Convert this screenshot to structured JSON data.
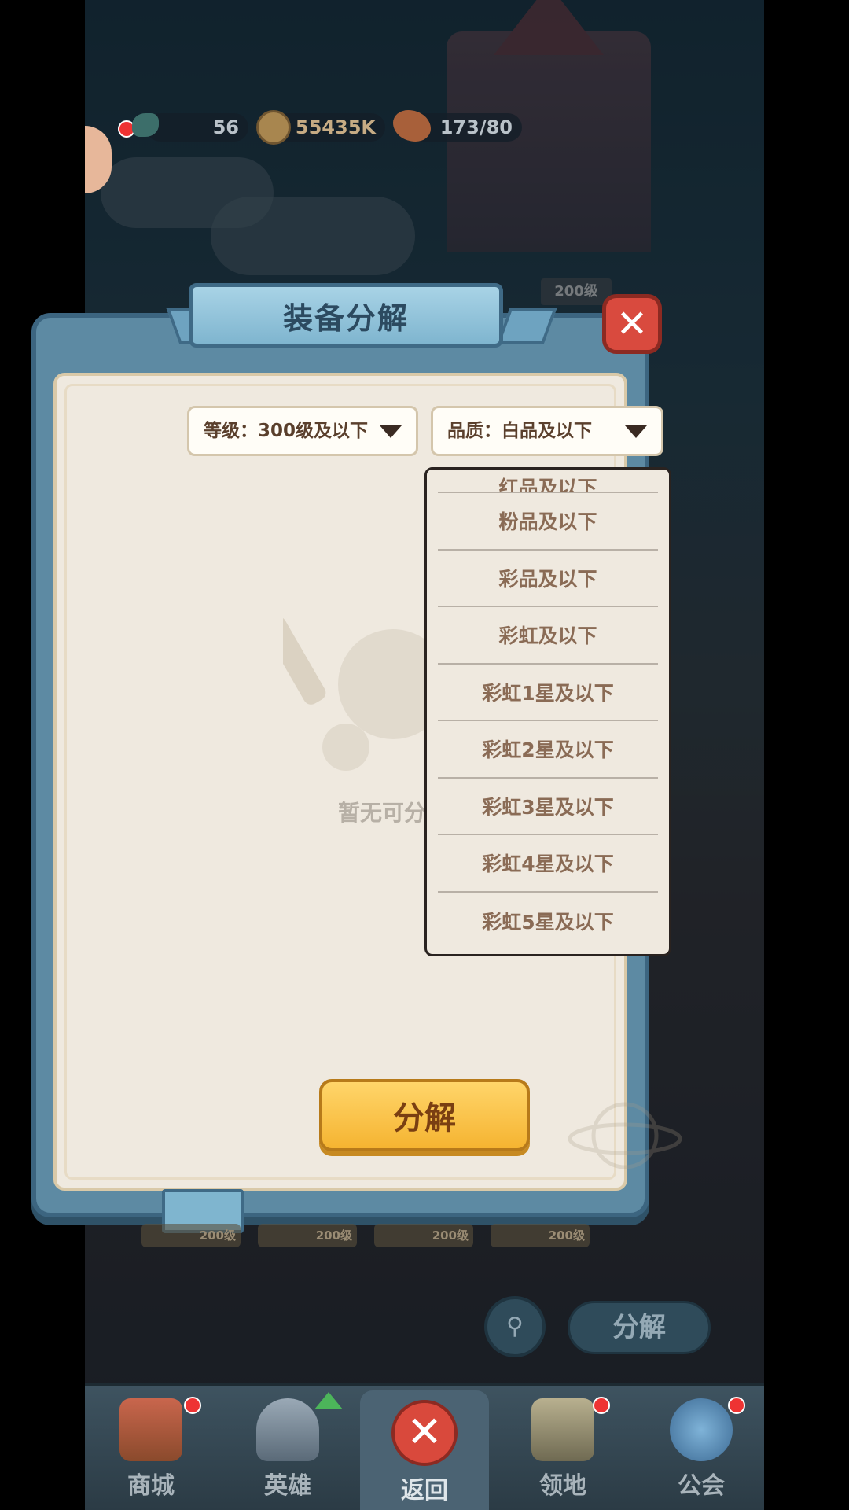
{
  "resources": {
    "energy": "56",
    "gold": "55435K",
    "food": "173/80"
  },
  "panel": {
    "title": "装备分解",
    "level_filter": "等级：300级及以下",
    "quality_filter": "品质：白品及以下",
    "quality_options_partial": "红品及以下",
    "quality_options": [
      "粉品及以下",
      "彩品及以下",
      "彩虹及以下",
      "彩虹1星及以下",
      "彩虹2星及以下",
      "彩虹3星及以下",
      "彩虹4星及以下",
      "彩虹5星及以下"
    ],
    "empty_text": "暂无可分",
    "decompose_button": "分解"
  },
  "background": {
    "level_badge": "200级",
    "item_levels": [
      "200级",
      "200级",
      "200级",
      "200级"
    ],
    "decompose_button": "分解"
  },
  "bottom_nav": [
    {
      "label": "商城",
      "icon": "shop-icon"
    },
    {
      "label": "英雄",
      "icon": "hero-helmet-icon"
    },
    {
      "label": "返回",
      "icon": "close-icon"
    },
    {
      "label": "领地",
      "icon": "castle-icon"
    },
    {
      "label": "公会",
      "icon": "planet-icon"
    }
  ],
  "colors": {
    "panel_frame": "#5d8aa3",
    "panel_paper": "#efe9df",
    "primary_button": "#f5b431",
    "close_red": "#d94a3e"
  }
}
